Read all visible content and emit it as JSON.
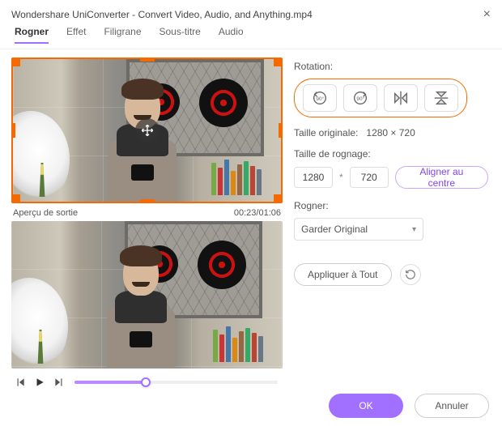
{
  "title": "Wondershare UniConverter - Convert Video, Audio, and Anything.mp4",
  "tabs": {
    "rogner": "Rogner",
    "effet": "Effet",
    "filigrane": "Filigrane",
    "soustitre": "Sous-titre",
    "audio": "Audio"
  },
  "preview_label": "Aperçu de sortie",
  "time_current": "00:23",
  "time_total": "01:06",
  "rotation_label": "Rotation:",
  "rot_ccw": "90°",
  "rot_cw": "90°",
  "orig_size_label": "Taille originale:",
  "orig_size_value": "1280 × 720",
  "crop_size_label": "Taille de rognage:",
  "crop_w": "1280",
  "crop_h": "720",
  "center_btn": "Aligner au centre",
  "rogner_label": "Rogner:",
  "rogner_value": "Garder Original",
  "apply_all": "Appliquer à Tout",
  "ok": "OK",
  "cancel": "Annuler",
  "colors": {
    "accent": "#a270ff",
    "highlight": "#f46a00"
  }
}
